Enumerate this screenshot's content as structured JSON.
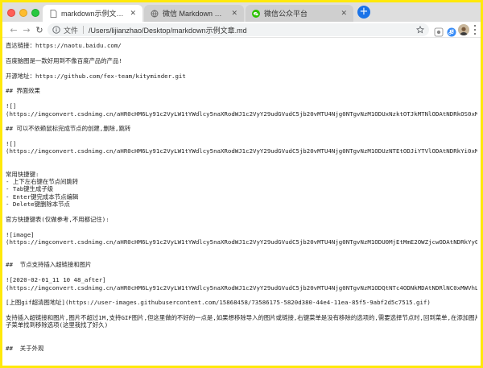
{
  "colors": {
    "background_accent": "#ffe90a",
    "active_tab": "#ffffff",
    "newtab_button": "#1a73e8"
  },
  "tabs": [
    {
      "label": "markdown示例文章.md",
      "icon": "file-icon",
      "active": true
    },
    {
      "label": "微信 Markdown 编辑器",
      "icon": "globe-icon",
      "active": false
    },
    {
      "label": "微信公众平台",
      "icon": "wechat-icon",
      "active": false
    }
  ],
  "toolbar": {
    "scheme": "文件",
    "url": "/Users/lijianzhao/Desktop/markdown示例文章.md",
    "newtab_symbol": "+"
  },
  "document": {
    "lines": [
      "直达链接：https://naotu.baidu.com/",
      "",
      "百度脑图是一款好用到不像百度产品的产品!",
      "",
      "开源地址：https://github.com/fex-team/kityminder.git",
      "",
      "## 界面效果",
      "",
      "![]",
      "(https://imgconvert.csdnimg.cn/aHR0cHM6Ly91c2VyLW1tYWdlcy5naXRodWJ1c2VyY29udGVudC5jb20vMTU4Njg0NTgvNzM1ODUxNzktOTJkMTNlODAtNDRkOS0xMWVhLThiYTAtMmY1YjEwMTBiZGQ3LnBuZw?x-oss-process=image/format,png)",
      "",
      "## 可以不依赖鼠标完成节点的创建,删除,跳转",
      "",
      "![]",
      "(https://imgconvert.csdnimg.cn/aHR0cHM6Ly91c2VyLW1tYWdlcy5naXRodWJ1c2VyY29udGVudC5jb20vMTU4Njg0NTgvNzM1ODUzNTEtODJiYTVlODAtNDRkYi0xMWVhLTg4ZTgtYTgxN2MxYzdjZmNhLmdpZg)",
      "",
      "",
      "常用快捷键:",
      "- 上下左右键在节点间跳转",
      "- Tab键生成子级",
      "- Enter键完成本节点编辑",
      "- Delete键删除本节点",
      "",
      "官方快捷键表(仅做参考,不用都记住):",
      "",
      "![image]",
      "(https://imgconvert.csdnimg.cn/aHR0cHM6Ly91c2VyLW1tYWdlcy5naXRodWJ1c2VyY29udGVudC5jb20vMTU4Njg0NTgvNzM1ODU0MjEtMmE2OWZjcwODAtNDRkYy0xMWVhLTgyOTEtZDRjZGQwNGQxYmIhLnBuZw?x-oss-process=image/format,png)",
      "",
      "",
      "##  节点支持插入超链接和图片",
      "",
      "![2020-02-01_11 10 48_after]",
      "(https://imgconvert.csdnimg.cn/aHR0cHM6Ly91c2VyLW1tYWdlcy5naXRodWJ1c2VyY29udGVudC5jb20vMTU4Njg0NTgvNzM1ODQtNTc4ODNkMDAtNDRlNC0xMWVhLTgwM2MtNjIwNDhkYmJkMDFhLmdpZg)",
      "",
      "[上图gif超清图地址](https://user-images.githubusercontent.com/15868458/73586175-5820d380-44e4-11ea-85f5-9abf2d5c7515.gif)",
      "",
      "支持插入超链接和图片,图片不超过1M,支持GIF图片,但这里做的不好的一点是,如果想移除导入的图片或链接,右键菜单是没有移除的选项的,需要选择节点时,回到菜单,在添加图片的",
      "子菜单找到移除选项(这里我找了好久)",
      "",
      "",
      "##  关于外观"
    ]
  }
}
